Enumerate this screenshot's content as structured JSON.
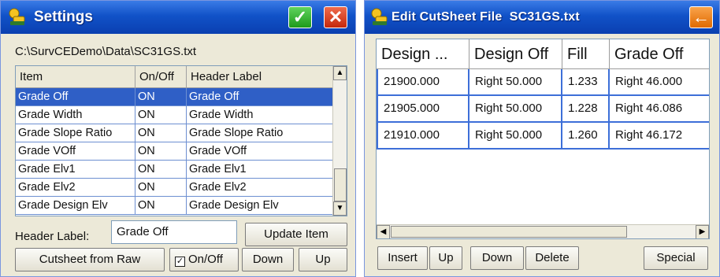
{
  "settings": {
    "title": "Settings",
    "ok_icon": "check-icon",
    "close_icon": "close-icon",
    "path": "C:\\SurvCEDemo\\Data\\SC31GS.txt",
    "columns": [
      "Item",
      "On/Off",
      "Header Label"
    ],
    "rows": [
      {
        "item": "Grade Off",
        "state": "ON",
        "label": "Grade Off",
        "selected": true
      },
      {
        "item": "Grade Width",
        "state": "ON",
        "label": "Grade Width"
      },
      {
        "item": "Grade Slope Ratio",
        "state": "ON",
        "label": "Grade Slope Ratio"
      },
      {
        "item": "Grade VOff",
        "state": "ON",
        "label": "Grade VOff"
      },
      {
        "item": "Grade Elv1",
        "state": "ON",
        "label": "Grade Elv1"
      },
      {
        "item": "Grade Elv2",
        "state": "ON",
        "label": "Grade Elv2"
      },
      {
        "item": "Grade Design Elv",
        "state": "ON",
        "label": "Grade Design Elv"
      }
    ],
    "header_label_caption": "Header Label:",
    "header_label_value": "Grade Off",
    "update_item": "Update Item",
    "cutsheet_from_raw": "Cutsheet from Raw",
    "onoff_label": "On/Off",
    "onoff_checked": true,
    "down": "Down",
    "up": "Up"
  },
  "edit": {
    "title": "Edit CutSheet File  SC31GS.txt",
    "back_icon": "arrow-left-icon",
    "columns": [
      "Design ...",
      "Design Off",
      "Fill",
      "Grade Off"
    ],
    "rows": [
      [
        "21900.000",
        "Right 50.000",
        "1.233",
        "Right 46.000"
      ],
      [
        "21905.000",
        "Right 50.000",
        "1.228",
        "Right 46.086"
      ],
      [
        "21910.000",
        "Right 50.000",
        "1.260",
        "Right 46.172"
      ]
    ],
    "insert": "Insert",
    "up": "Up",
    "down": "Down",
    "delete": "Delete",
    "special": "Special"
  },
  "colors": {
    "title_bar": "#1152c8",
    "selection": "#2f5fc6",
    "ok": "#1e9a1b",
    "close": "#c4280c",
    "back": "#e06a00"
  }
}
